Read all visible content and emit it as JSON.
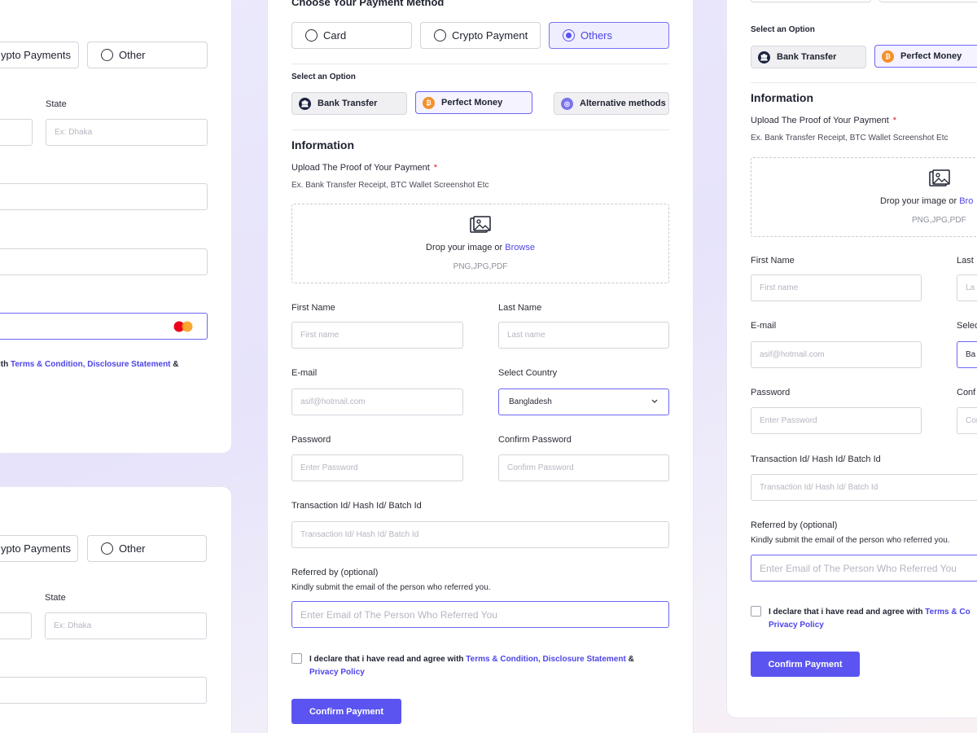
{
  "section_title": "Choose Your Payment Method",
  "methods": {
    "card": "Card",
    "crypto": "Crypto Payment",
    "crypto_alt": "Crypto Payments",
    "others": "Others",
    "other": "Other"
  },
  "select_option": "Select an Option",
  "options": {
    "bank": "Bank Transfer",
    "perfect": "Perfect Money",
    "alternative": "Alternative methods"
  },
  "info": {
    "heading": "Information",
    "upload_label": "Upload The Proof of Your Payment",
    "required_mark": "*",
    "upload_hint": "Ex. Bank Transfer Receipt, BTC Wallet Screenshot Etc",
    "drop_text": "Drop your image or ",
    "browse": "Browse",
    "formats": "PNG,JPG,PDF"
  },
  "fields": {
    "first_name": {
      "label": "First Name",
      "placeholder": "First name"
    },
    "last_name": {
      "label": "Last Name",
      "placeholder": "Last name"
    },
    "email": {
      "label": "E-mail",
      "placeholder": "asif@hotmail.com"
    },
    "country": {
      "label": "Select Country",
      "value": "Bangladesh"
    },
    "password": {
      "label": "Password",
      "placeholder": "Enter Password"
    },
    "confirm": {
      "label": "Confirm Password",
      "placeholder": "Confirm Password"
    },
    "txn": {
      "label": "Transaction Id/ Hash Id/ Batch Id",
      "placeholder": "Transaction Id/ Hash Id/ Batch Id"
    },
    "referred": {
      "label": "Referred by (optional)",
      "hint": "Kindly submit the email of the person who referred you.",
      "placeholder": "Enter Email of The Person Who Referred You"
    },
    "state": {
      "label": "State",
      "placeholder": "Ex: Dhaka"
    }
  },
  "declare": {
    "prefix": "I declare that i have read and agree with ",
    "terms": "Terms & Condition, Disclosure Statement",
    "and": " &",
    "privacy": "Privacy Policy",
    "left_prefix": "ith ",
    "right_cut": "Terms & Co"
  },
  "confirm_button": "Confirm Payment",
  "truncated": {
    "crypto_left": "ypto Payments",
    "browse_right": "Bro",
    "last_right": "Last",
    "last_ph_right": "La",
    "select_right": "Selec",
    "select_val_right": "Ba",
    "conf_right": "Conf",
    "conf_ph_right": "Con"
  },
  "colors": {
    "accent": "#5b54f0",
    "required": "#e0192c",
    "mastercard_red": "#eb001b",
    "mastercard_orange": "#f79e1b"
  }
}
